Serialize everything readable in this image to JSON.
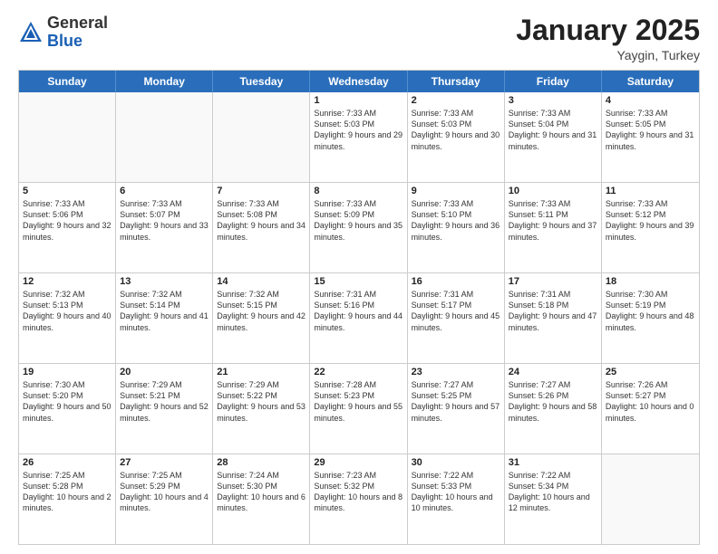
{
  "logo": {
    "general": "General",
    "blue": "Blue"
  },
  "header": {
    "month": "January 2025",
    "location": "Yaygin, Turkey"
  },
  "weekdays": [
    "Sunday",
    "Monday",
    "Tuesday",
    "Wednesday",
    "Thursday",
    "Friday",
    "Saturday"
  ],
  "weeks": [
    [
      {
        "day": "",
        "sunrise": "",
        "sunset": "",
        "daylight": ""
      },
      {
        "day": "",
        "sunrise": "",
        "sunset": "",
        "daylight": ""
      },
      {
        "day": "",
        "sunrise": "",
        "sunset": "",
        "daylight": ""
      },
      {
        "day": "1",
        "sunrise": "Sunrise: 7:33 AM",
        "sunset": "Sunset: 5:03 PM",
        "daylight": "Daylight: 9 hours and 29 minutes."
      },
      {
        "day": "2",
        "sunrise": "Sunrise: 7:33 AM",
        "sunset": "Sunset: 5:03 PM",
        "daylight": "Daylight: 9 hours and 30 minutes."
      },
      {
        "day": "3",
        "sunrise": "Sunrise: 7:33 AM",
        "sunset": "Sunset: 5:04 PM",
        "daylight": "Daylight: 9 hours and 31 minutes."
      },
      {
        "day": "4",
        "sunrise": "Sunrise: 7:33 AM",
        "sunset": "Sunset: 5:05 PM",
        "daylight": "Daylight: 9 hours and 31 minutes."
      }
    ],
    [
      {
        "day": "5",
        "sunrise": "Sunrise: 7:33 AM",
        "sunset": "Sunset: 5:06 PM",
        "daylight": "Daylight: 9 hours and 32 minutes."
      },
      {
        "day": "6",
        "sunrise": "Sunrise: 7:33 AM",
        "sunset": "Sunset: 5:07 PM",
        "daylight": "Daylight: 9 hours and 33 minutes."
      },
      {
        "day": "7",
        "sunrise": "Sunrise: 7:33 AM",
        "sunset": "Sunset: 5:08 PM",
        "daylight": "Daylight: 9 hours and 34 minutes."
      },
      {
        "day": "8",
        "sunrise": "Sunrise: 7:33 AM",
        "sunset": "Sunset: 5:09 PM",
        "daylight": "Daylight: 9 hours and 35 minutes."
      },
      {
        "day": "9",
        "sunrise": "Sunrise: 7:33 AM",
        "sunset": "Sunset: 5:10 PM",
        "daylight": "Daylight: 9 hours and 36 minutes."
      },
      {
        "day": "10",
        "sunrise": "Sunrise: 7:33 AM",
        "sunset": "Sunset: 5:11 PM",
        "daylight": "Daylight: 9 hours and 37 minutes."
      },
      {
        "day": "11",
        "sunrise": "Sunrise: 7:33 AM",
        "sunset": "Sunset: 5:12 PM",
        "daylight": "Daylight: 9 hours and 39 minutes."
      }
    ],
    [
      {
        "day": "12",
        "sunrise": "Sunrise: 7:32 AM",
        "sunset": "Sunset: 5:13 PM",
        "daylight": "Daylight: 9 hours and 40 minutes."
      },
      {
        "day": "13",
        "sunrise": "Sunrise: 7:32 AM",
        "sunset": "Sunset: 5:14 PM",
        "daylight": "Daylight: 9 hours and 41 minutes."
      },
      {
        "day": "14",
        "sunrise": "Sunrise: 7:32 AM",
        "sunset": "Sunset: 5:15 PM",
        "daylight": "Daylight: 9 hours and 42 minutes."
      },
      {
        "day": "15",
        "sunrise": "Sunrise: 7:31 AM",
        "sunset": "Sunset: 5:16 PM",
        "daylight": "Daylight: 9 hours and 44 minutes."
      },
      {
        "day": "16",
        "sunrise": "Sunrise: 7:31 AM",
        "sunset": "Sunset: 5:17 PM",
        "daylight": "Daylight: 9 hours and 45 minutes."
      },
      {
        "day": "17",
        "sunrise": "Sunrise: 7:31 AM",
        "sunset": "Sunset: 5:18 PM",
        "daylight": "Daylight: 9 hours and 47 minutes."
      },
      {
        "day": "18",
        "sunrise": "Sunrise: 7:30 AM",
        "sunset": "Sunset: 5:19 PM",
        "daylight": "Daylight: 9 hours and 48 minutes."
      }
    ],
    [
      {
        "day": "19",
        "sunrise": "Sunrise: 7:30 AM",
        "sunset": "Sunset: 5:20 PM",
        "daylight": "Daylight: 9 hours and 50 minutes."
      },
      {
        "day": "20",
        "sunrise": "Sunrise: 7:29 AM",
        "sunset": "Sunset: 5:21 PM",
        "daylight": "Daylight: 9 hours and 52 minutes."
      },
      {
        "day": "21",
        "sunrise": "Sunrise: 7:29 AM",
        "sunset": "Sunset: 5:22 PM",
        "daylight": "Daylight: 9 hours and 53 minutes."
      },
      {
        "day": "22",
        "sunrise": "Sunrise: 7:28 AM",
        "sunset": "Sunset: 5:23 PM",
        "daylight": "Daylight: 9 hours and 55 minutes."
      },
      {
        "day": "23",
        "sunrise": "Sunrise: 7:27 AM",
        "sunset": "Sunset: 5:25 PM",
        "daylight": "Daylight: 9 hours and 57 minutes."
      },
      {
        "day": "24",
        "sunrise": "Sunrise: 7:27 AM",
        "sunset": "Sunset: 5:26 PM",
        "daylight": "Daylight: 9 hours and 58 minutes."
      },
      {
        "day": "25",
        "sunrise": "Sunrise: 7:26 AM",
        "sunset": "Sunset: 5:27 PM",
        "daylight": "Daylight: 10 hours and 0 minutes."
      }
    ],
    [
      {
        "day": "26",
        "sunrise": "Sunrise: 7:25 AM",
        "sunset": "Sunset: 5:28 PM",
        "daylight": "Daylight: 10 hours and 2 minutes."
      },
      {
        "day": "27",
        "sunrise": "Sunrise: 7:25 AM",
        "sunset": "Sunset: 5:29 PM",
        "daylight": "Daylight: 10 hours and 4 minutes."
      },
      {
        "day": "28",
        "sunrise": "Sunrise: 7:24 AM",
        "sunset": "Sunset: 5:30 PM",
        "daylight": "Daylight: 10 hours and 6 minutes."
      },
      {
        "day": "29",
        "sunrise": "Sunrise: 7:23 AM",
        "sunset": "Sunset: 5:32 PM",
        "daylight": "Daylight: 10 hours and 8 minutes."
      },
      {
        "day": "30",
        "sunrise": "Sunrise: 7:22 AM",
        "sunset": "Sunset: 5:33 PM",
        "daylight": "Daylight: 10 hours and 10 minutes."
      },
      {
        "day": "31",
        "sunrise": "Sunrise: 7:22 AM",
        "sunset": "Sunset: 5:34 PM",
        "daylight": "Daylight: 10 hours and 12 minutes."
      },
      {
        "day": "",
        "sunrise": "",
        "sunset": "",
        "daylight": ""
      }
    ]
  ]
}
